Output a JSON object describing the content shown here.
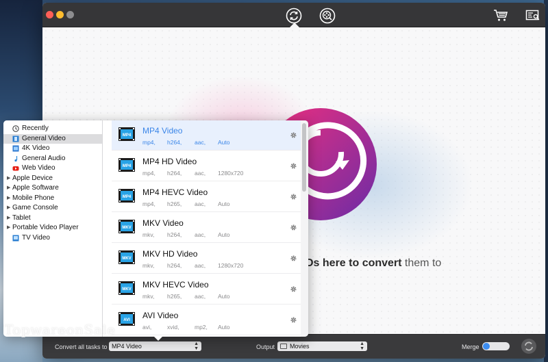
{
  "footer": {
    "convert_label": "Convert all tasks to",
    "convert_value": "MP4 Video",
    "output_label": "Output",
    "output_value": "Movies",
    "merge_label": "Merge"
  },
  "main": {
    "drop_strong": "Ds here to convert",
    "drop_light": " them to"
  },
  "categories": [
    {
      "label": "Recently",
      "icon": "clock-icon",
      "expandable": false,
      "selected": false
    },
    {
      "label": "General Video",
      "icon": "film-icon",
      "expandable": false,
      "selected": true
    },
    {
      "label": "4K Video",
      "icon": "4k-icon",
      "expandable": false,
      "selected": false
    },
    {
      "label": "General Audio",
      "icon": "music-note-icon",
      "expandable": false,
      "selected": false
    },
    {
      "label": "Web Video",
      "icon": "youtube-icon",
      "expandable": false,
      "selected": false
    },
    {
      "label": "Apple Device",
      "expandable": true,
      "selected": false
    },
    {
      "label": "Apple Software",
      "expandable": true,
      "selected": false
    },
    {
      "label": "Mobile Phone",
      "expandable": true,
      "selected": false
    },
    {
      "label": "Game Console",
      "expandable": true,
      "selected": false
    },
    {
      "label": "Tablet",
      "expandable": true,
      "selected": false
    },
    {
      "label": "Portable Video Player",
      "expandable": true,
      "selected": false
    },
    {
      "label": "TV Video",
      "icon": "tv-icon",
      "expandable": false,
      "selected": false
    }
  ],
  "formats": [
    {
      "title": "MP4 Video",
      "badge": "MP4",
      "meta": [
        "mp4,",
        "h264,",
        "aac,",
        "Auto"
      ],
      "active": true
    },
    {
      "title": "MP4 HD Video",
      "badge": "MP4",
      "meta": [
        "mp4,",
        "h264,",
        "aac,",
        "1280x720"
      ],
      "active": false
    },
    {
      "title": "MP4 HEVC Video",
      "badge": "MP4",
      "meta": [
        "mp4,",
        "h265,",
        "aac,",
        "Auto"
      ],
      "active": false
    },
    {
      "title": "MKV Video",
      "badge": "MKV",
      "meta": [
        "mkv,",
        "h264,",
        "aac,",
        "Auto"
      ],
      "active": false
    },
    {
      "title": "MKV HD Video",
      "badge": "MKV",
      "meta": [
        "mkv,",
        "h264,",
        "aac,",
        "1280x720"
      ],
      "active": false
    },
    {
      "title": "MKV HEVC Video",
      "badge": "MKV",
      "meta": [
        "mkv,",
        "h265,",
        "aac,",
        "Auto"
      ],
      "active": false
    },
    {
      "title": "AVI Video",
      "badge": "AVI",
      "meta": [
        "avi,",
        "xvid,",
        "mp2,",
        "Auto"
      ],
      "active": false
    }
  ],
  "watermark": "TopwareonSale",
  "colors": {
    "accent": "#3b86e8",
    "selection": "#e8f0fd",
    "hero_pink": "#e8307a",
    "hero_purple": "#7a2fa8"
  }
}
